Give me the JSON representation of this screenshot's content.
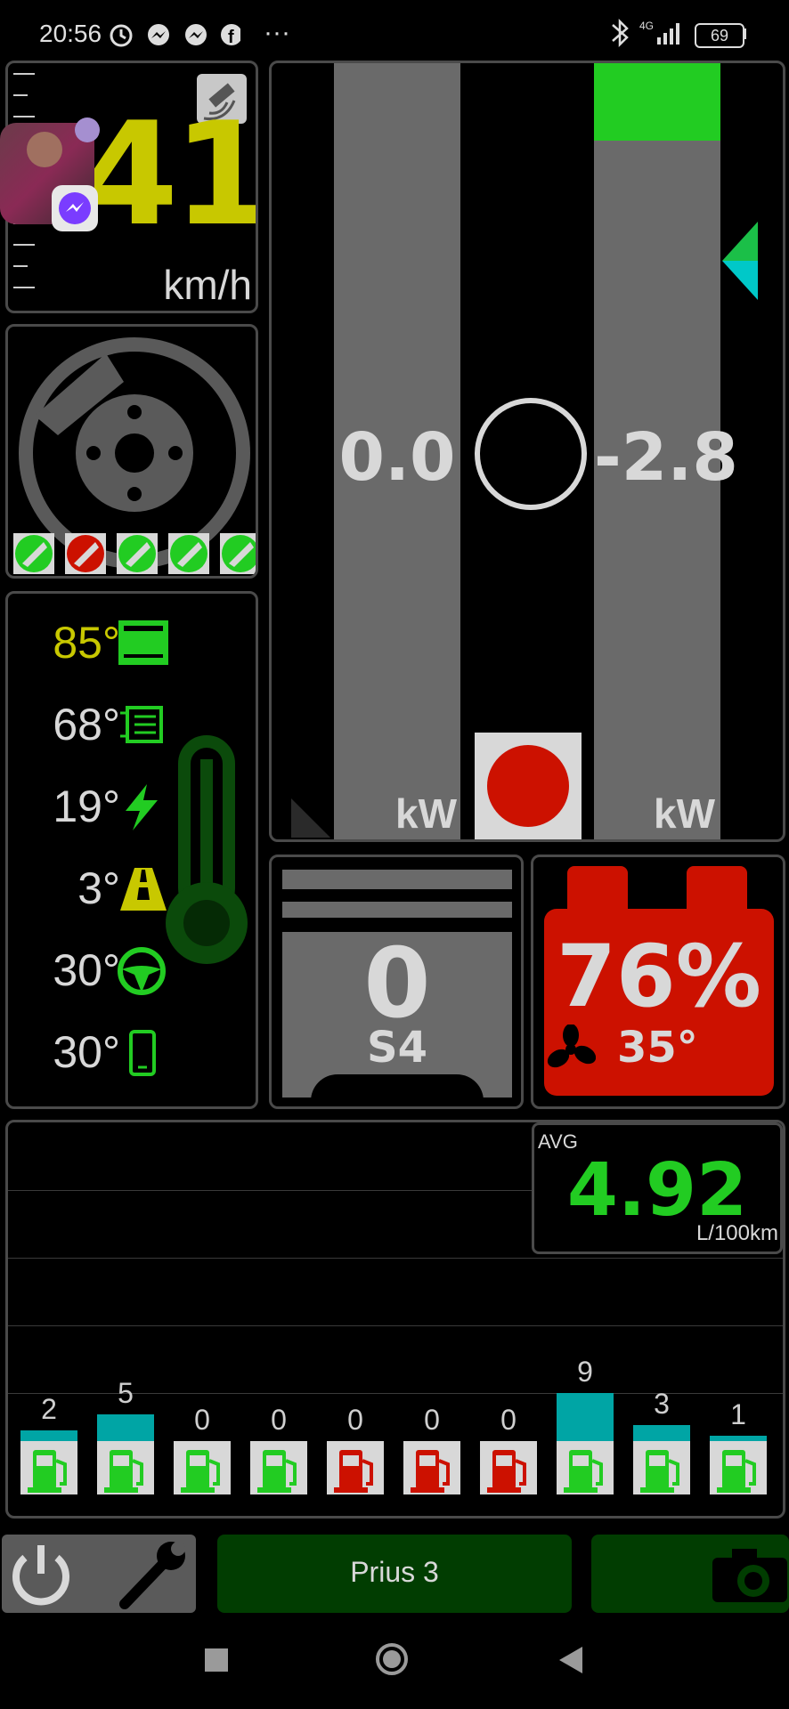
{
  "status_bar": {
    "time": "20:56",
    "network": "4G",
    "battery": "69",
    "more": "···"
  },
  "speed": {
    "value": "41",
    "unit": "km/h"
  },
  "brake_wear": {
    "pads": [
      "ok",
      "bad",
      "ok",
      "ok",
      "ok"
    ]
  },
  "temperatures": [
    {
      "value": "85°",
      "icon": "engine-coolant-icon",
      "color": "#c8c800"
    },
    {
      "value": "68°",
      "icon": "inverter-icon",
      "color": "#d8d8d8"
    },
    {
      "value": "19°",
      "icon": "battery-lightning-icon",
      "color": "#d8d8d8"
    },
    {
      "value": "3°",
      "icon": "road-icon",
      "color": "#d8d8d8"
    },
    {
      "value": "30°",
      "icon": "steering-wheel-icon",
      "color": "#d8d8d8"
    },
    {
      "value": "30°",
      "icon": "phone-icon",
      "color": "#d8d8d8"
    }
  ],
  "power": {
    "left_value": "0.0",
    "left_unit": "kW",
    "right_value": "-2.8",
    "right_unit": "kW",
    "right_fill_fraction": 0.1
  },
  "gear": {
    "value": "0",
    "label": "S4"
  },
  "battery": {
    "percent": "76%",
    "fan_temp": "35°"
  },
  "consumption": {
    "avg_label": "AVG",
    "avg_value": "4.92",
    "unit": "L/100km",
    "bars": [
      {
        "value": "2",
        "level": 2,
        "pump_color": "green"
      },
      {
        "value": "5",
        "level": 5,
        "pump_color": "green"
      },
      {
        "value": "0",
        "level": 0,
        "pump_color": "green"
      },
      {
        "value": "0",
        "level": 0,
        "pump_color": "green"
      },
      {
        "value": "0",
        "level": 0,
        "pump_color": "red"
      },
      {
        "value": "0",
        "level": 0,
        "pump_color": "red"
      },
      {
        "value": "0",
        "level": 0,
        "pump_color": "red"
      },
      {
        "value": "9",
        "level": 9,
        "pump_color": "green"
      },
      {
        "value": "3",
        "level": 3,
        "pump_color": "green"
      },
      {
        "value": "1",
        "level": 1,
        "pump_color": "green"
      }
    ]
  },
  "bottom": {
    "profile_label": "Prius 3"
  },
  "colors": {
    "accent_green": "#22cc22",
    "accent_red": "#cc1100",
    "panel_border": "#4a4a4a",
    "yellow": "#c8c800"
  }
}
